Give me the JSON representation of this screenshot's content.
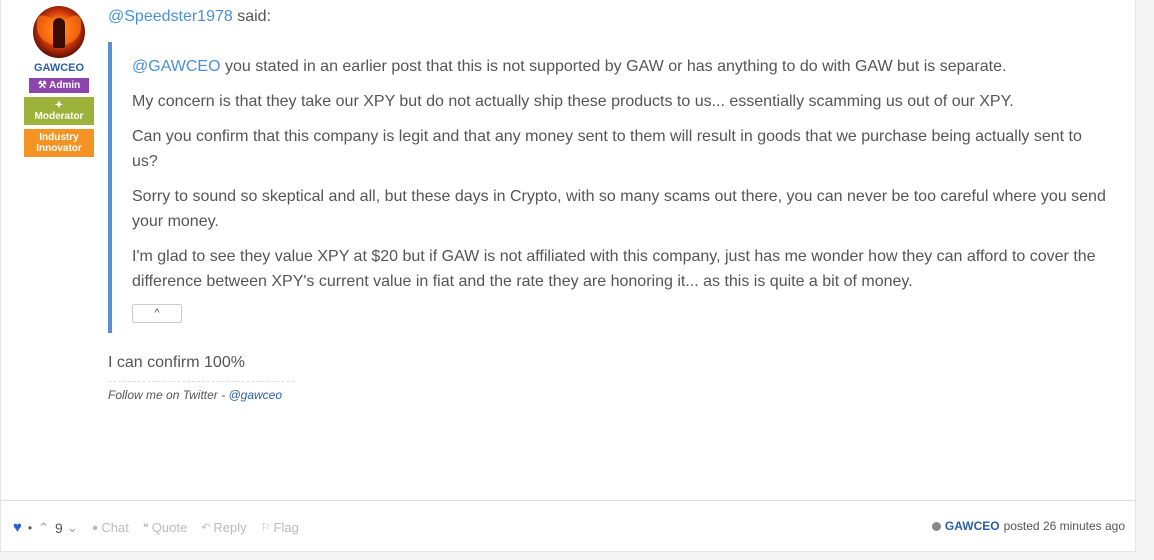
{
  "author": {
    "username": "GAWCEO",
    "badges": {
      "admin": "Admin",
      "moderator": "Moderator",
      "industry": "Industry Innovator"
    }
  },
  "post": {
    "quote_user": "@Speedster1978",
    "said": " said:",
    "quote": {
      "mention": "@GAWCEO",
      "p1_rest": " you stated in an earlier post that this is not supported by GAW or has anything to do with GAW but is separate.",
      "p2": "My concern is that they take our XPY but do not actually ship these products to us... essentially scamming us out of our XPY.",
      "p3": "Can you confirm that this company is legit and that any money sent to them will result in goods that we purchase being actually sent to us?",
      "p4": "Sorry to sound so skeptical and all, but these days in Crypto, with so many scams out there, you can never be too careful where you send your money.",
      "p5": "I'm glad to see they value XPY at $20 but if GAW is not affiliated with this company, just has me wonder how they can afford to cover the difference between XPY's current value in fiat and the rate they are honoring it... as this is quite a bit of money.",
      "collapse_icon": "^"
    },
    "body": "I can confirm 100%",
    "signature": {
      "text": "Follow me on Twitter - ",
      "link": "@gawceo"
    }
  },
  "footer": {
    "vote_count": "9",
    "chat": "Chat",
    "quote": "Quote",
    "reply": "Reply",
    "flag": "Flag",
    "posted_user": "GAWCEO",
    "posted_text": "posted 26 minutes ago"
  }
}
